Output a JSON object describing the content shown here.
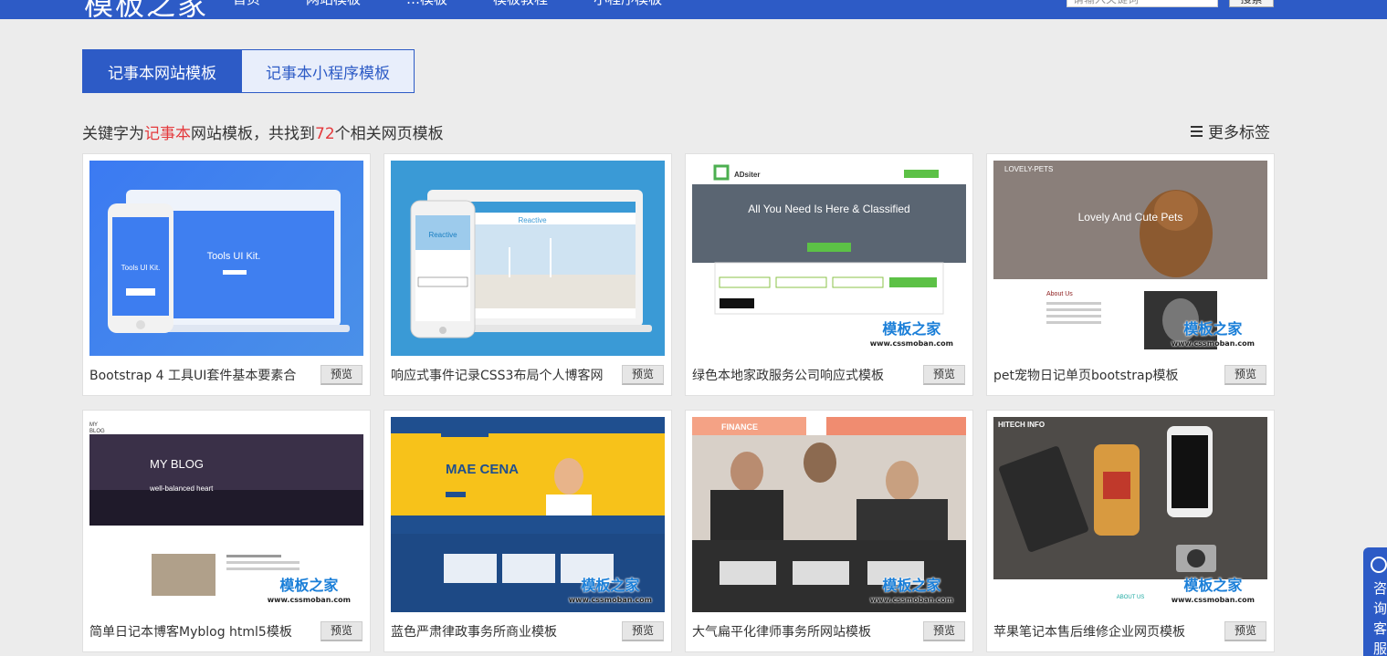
{
  "header": {
    "logo": "模板之家",
    "nav": [
      "首页",
      "网站模板",
      "…模板",
      "模板教程",
      "小程序模板"
    ],
    "search_placeholder": "请输入关键词",
    "search_button": "搜索"
  },
  "tabs": [
    {
      "label": "记事本网站模板",
      "active": true
    },
    {
      "label": "记事本小程序模板",
      "active": false
    }
  ],
  "result": {
    "prefix": "关键字为",
    "keyword": "记事本",
    "middle": "网站模板，共找到",
    "count": "72",
    "suffix": "个相关网页模板"
  },
  "more_tags": "更多标签",
  "preview_label": "预览",
  "watermark": {
    "name": "模板之家",
    "url": "www.cssmoban.com"
  },
  "cards": [
    {
      "title": "Bootstrap 4 工具UI套件基本要素合",
      "thumb_text": "Tools UI Kit."
    },
    {
      "title": "响应式事件记录CSS3布局个人博客网",
      "thumb_text": "Reactive"
    },
    {
      "title": "绿色本地家政服务公司响应式模板",
      "thumb_text": "All You Need Is Here & Classified"
    },
    {
      "title": "pet宠物日记单页bootstrap模板",
      "thumb_text": "Lovely And Cute Pets"
    },
    {
      "title": "简单日记本博客Myblog html5模板",
      "thumb_text": "MY BLOG"
    },
    {
      "title": "蓝色严肃律政事务所商业模板",
      "thumb_text": "MAE CENA"
    },
    {
      "title": "大气扁平化律师事务所网站模板",
      "thumb_text": "FINANCE"
    },
    {
      "title": "苹果笔记本售后维修企业网页模板",
      "thumb_text": "HITECH INFO"
    }
  ],
  "chat": "咨询客服"
}
